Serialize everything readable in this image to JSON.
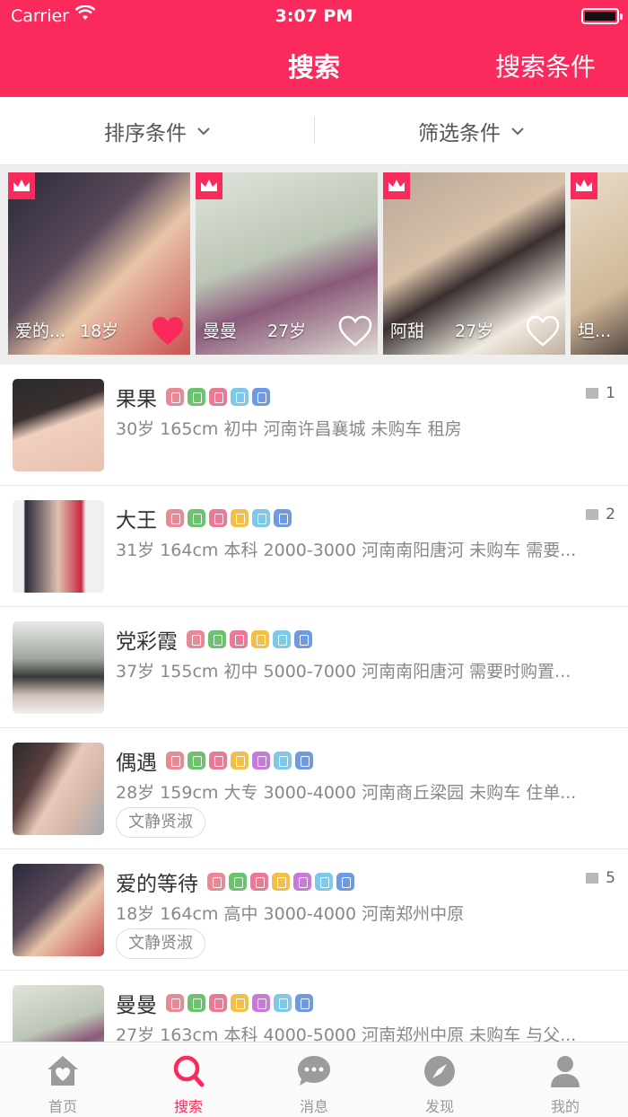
{
  "status": {
    "carrier": "Carrier",
    "time": "3:07 PM"
  },
  "nav": {
    "title": "搜索",
    "right_label": "搜索条件"
  },
  "filters": {
    "sort_label": "排序条件",
    "filter_label": "筛选条件"
  },
  "featured": [
    {
      "name": "爱的...",
      "age": "18岁",
      "liked": true
    },
    {
      "name": "曼曼",
      "age": "27岁",
      "liked": false
    },
    {
      "name": "阿甜",
      "age": "27岁",
      "liked": false
    },
    {
      "name": "坦...",
      "age": "",
      "liked": false
    }
  ],
  "users": [
    {
      "name": "果果",
      "info": "30岁 165cm 初中  河南许昌襄城 未购车 租房",
      "tag": "",
      "images": "1"
    },
    {
      "name": "大王",
      "info": "31岁 164cm 本科 2000-3000 河南南阳唐河 未购车 需要...",
      "tag": "",
      "images": "2"
    },
    {
      "name": "党彩霞",
      "info": "37岁 155cm 初中 5000-7000 河南南阳唐河 需要时购置...",
      "tag": "",
      "images": ""
    },
    {
      "name": "偶遇",
      "info": "28岁 159cm 大专 3000-4000 河南商丘梁园 未购车 住单...",
      "tag": "文静贤淑",
      "images": ""
    },
    {
      "name": "爱的等待",
      "info": "18岁 164cm 高中 3000-4000 河南郑州中原",
      "tag": "文静贤淑",
      "images": "5"
    },
    {
      "name": "曼曼",
      "info": "27岁 163cm 本科 4000-5000 河南郑州中原 未购车 与父...",
      "tag": "",
      "images": ""
    }
  ],
  "tabs": [
    {
      "label": "首页",
      "icon": "home-heart-icon"
    },
    {
      "label": "搜索",
      "icon": "search-icon"
    },
    {
      "label": "消息",
      "icon": "chat-bubble-icon"
    },
    {
      "label": "发现",
      "icon": "compass-icon"
    },
    {
      "label": "我的",
      "icon": "person-icon"
    }
  ],
  "colors": {
    "brand": "#fb2a5c",
    "tab_inactive": "#9b9b9b"
  }
}
